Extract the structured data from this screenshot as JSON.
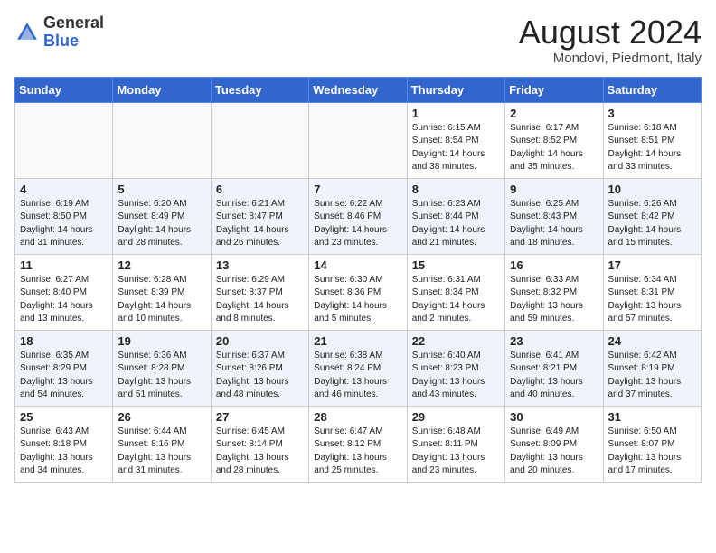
{
  "header": {
    "logo_general": "General",
    "logo_blue": "Blue",
    "month_year": "August 2024",
    "location": "Mondovi, Piedmont, Italy"
  },
  "weekdays": [
    "Sunday",
    "Monday",
    "Tuesday",
    "Wednesday",
    "Thursday",
    "Friday",
    "Saturday"
  ],
  "weeks": [
    [
      {
        "day": "",
        "info": ""
      },
      {
        "day": "",
        "info": ""
      },
      {
        "day": "",
        "info": ""
      },
      {
        "day": "",
        "info": ""
      },
      {
        "day": "1",
        "info": "Sunrise: 6:15 AM\nSunset: 8:54 PM\nDaylight: 14 hours\nand 38 minutes."
      },
      {
        "day": "2",
        "info": "Sunrise: 6:17 AM\nSunset: 8:52 PM\nDaylight: 14 hours\nand 35 minutes."
      },
      {
        "day": "3",
        "info": "Sunrise: 6:18 AM\nSunset: 8:51 PM\nDaylight: 14 hours\nand 33 minutes."
      }
    ],
    [
      {
        "day": "4",
        "info": "Sunrise: 6:19 AM\nSunset: 8:50 PM\nDaylight: 14 hours\nand 31 minutes."
      },
      {
        "day": "5",
        "info": "Sunrise: 6:20 AM\nSunset: 8:49 PM\nDaylight: 14 hours\nand 28 minutes."
      },
      {
        "day": "6",
        "info": "Sunrise: 6:21 AM\nSunset: 8:47 PM\nDaylight: 14 hours\nand 26 minutes."
      },
      {
        "day": "7",
        "info": "Sunrise: 6:22 AM\nSunset: 8:46 PM\nDaylight: 14 hours\nand 23 minutes."
      },
      {
        "day": "8",
        "info": "Sunrise: 6:23 AM\nSunset: 8:44 PM\nDaylight: 14 hours\nand 21 minutes."
      },
      {
        "day": "9",
        "info": "Sunrise: 6:25 AM\nSunset: 8:43 PM\nDaylight: 14 hours\nand 18 minutes."
      },
      {
        "day": "10",
        "info": "Sunrise: 6:26 AM\nSunset: 8:42 PM\nDaylight: 14 hours\nand 15 minutes."
      }
    ],
    [
      {
        "day": "11",
        "info": "Sunrise: 6:27 AM\nSunset: 8:40 PM\nDaylight: 14 hours\nand 13 minutes."
      },
      {
        "day": "12",
        "info": "Sunrise: 6:28 AM\nSunset: 8:39 PM\nDaylight: 14 hours\nand 10 minutes."
      },
      {
        "day": "13",
        "info": "Sunrise: 6:29 AM\nSunset: 8:37 PM\nDaylight: 14 hours\nand 8 minutes."
      },
      {
        "day": "14",
        "info": "Sunrise: 6:30 AM\nSunset: 8:36 PM\nDaylight: 14 hours\nand 5 minutes."
      },
      {
        "day": "15",
        "info": "Sunrise: 6:31 AM\nSunset: 8:34 PM\nDaylight: 14 hours\nand 2 minutes."
      },
      {
        "day": "16",
        "info": "Sunrise: 6:33 AM\nSunset: 8:32 PM\nDaylight: 13 hours\nand 59 minutes."
      },
      {
        "day": "17",
        "info": "Sunrise: 6:34 AM\nSunset: 8:31 PM\nDaylight: 13 hours\nand 57 minutes."
      }
    ],
    [
      {
        "day": "18",
        "info": "Sunrise: 6:35 AM\nSunset: 8:29 PM\nDaylight: 13 hours\nand 54 minutes."
      },
      {
        "day": "19",
        "info": "Sunrise: 6:36 AM\nSunset: 8:28 PM\nDaylight: 13 hours\nand 51 minutes."
      },
      {
        "day": "20",
        "info": "Sunrise: 6:37 AM\nSunset: 8:26 PM\nDaylight: 13 hours\nand 48 minutes."
      },
      {
        "day": "21",
        "info": "Sunrise: 6:38 AM\nSunset: 8:24 PM\nDaylight: 13 hours\nand 46 minutes."
      },
      {
        "day": "22",
        "info": "Sunrise: 6:40 AM\nSunset: 8:23 PM\nDaylight: 13 hours\nand 43 minutes."
      },
      {
        "day": "23",
        "info": "Sunrise: 6:41 AM\nSunset: 8:21 PM\nDaylight: 13 hours\nand 40 minutes."
      },
      {
        "day": "24",
        "info": "Sunrise: 6:42 AM\nSunset: 8:19 PM\nDaylight: 13 hours\nand 37 minutes."
      }
    ],
    [
      {
        "day": "25",
        "info": "Sunrise: 6:43 AM\nSunset: 8:18 PM\nDaylight: 13 hours\nand 34 minutes."
      },
      {
        "day": "26",
        "info": "Sunrise: 6:44 AM\nSunset: 8:16 PM\nDaylight: 13 hours\nand 31 minutes."
      },
      {
        "day": "27",
        "info": "Sunrise: 6:45 AM\nSunset: 8:14 PM\nDaylight: 13 hours\nand 28 minutes."
      },
      {
        "day": "28",
        "info": "Sunrise: 6:47 AM\nSunset: 8:12 PM\nDaylight: 13 hours\nand 25 minutes."
      },
      {
        "day": "29",
        "info": "Sunrise: 6:48 AM\nSunset: 8:11 PM\nDaylight: 13 hours\nand 23 minutes."
      },
      {
        "day": "30",
        "info": "Sunrise: 6:49 AM\nSunset: 8:09 PM\nDaylight: 13 hours\nand 20 minutes."
      },
      {
        "day": "31",
        "info": "Sunrise: 6:50 AM\nSunset: 8:07 PM\nDaylight: 13 hours\nand 17 minutes."
      }
    ]
  ]
}
